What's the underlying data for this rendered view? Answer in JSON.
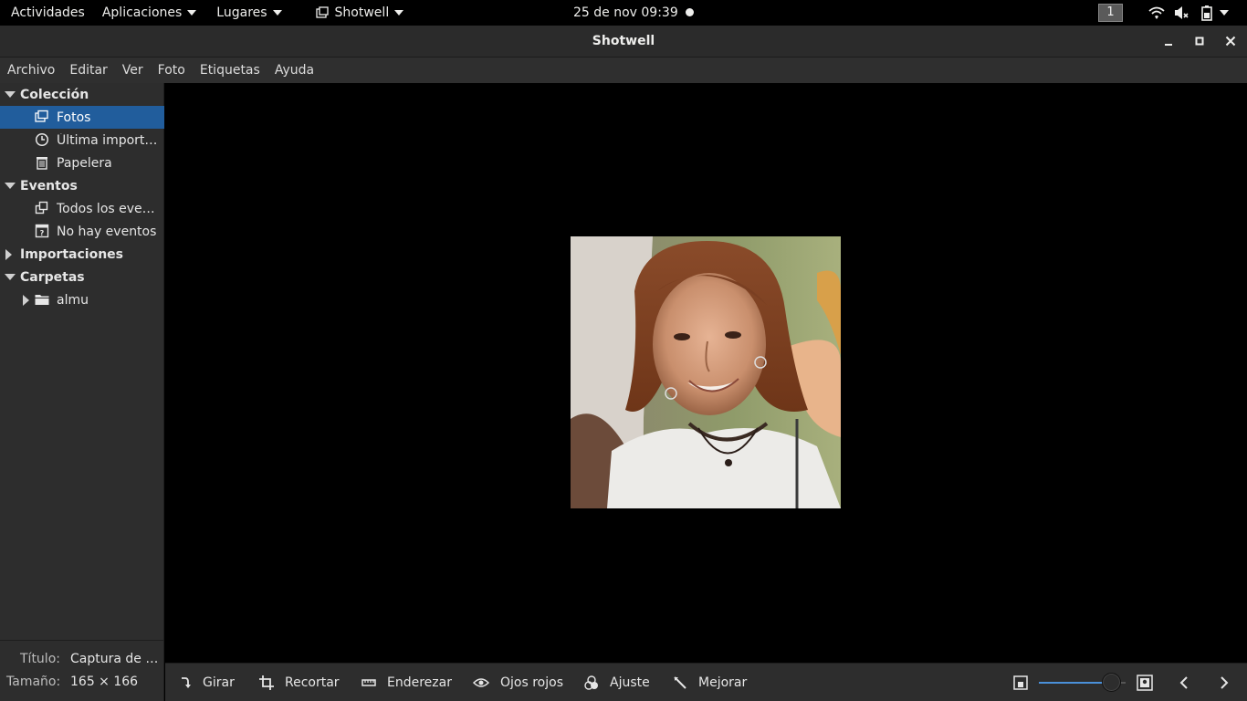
{
  "topbar": {
    "activities": "Actividades",
    "applications": "Aplicaciones",
    "places": "Lugares",
    "app_name": "Shotwell",
    "clock": "25 de nov  09:39",
    "workspace": "1"
  },
  "window": {
    "title": "Shotwell"
  },
  "menu": {
    "items": [
      "Archivo",
      "Editar",
      "Ver",
      "Foto",
      "Etiquetas",
      "Ayuda"
    ]
  },
  "sidebar": {
    "collection_header": "Colección",
    "photos": "Fotos",
    "last_import": "Última importa…",
    "trash": "Papelera",
    "events_header": "Eventos",
    "all_events": "Todos los event…",
    "no_events": "No hay eventos",
    "imports_header": "Importaciones",
    "folders_header": "Carpetas",
    "folder_almu": "almu"
  },
  "info": {
    "title_label": "Título:",
    "title_value": "Captura de pa…",
    "size_label": "Tamaño:",
    "size_value": "165 × 166"
  },
  "toolbar": {
    "rotate": "Girar",
    "crop": "Recortar",
    "straighten": "Enderezar",
    "red_eye": "Ojos rojos",
    "adjust": "Ajuste",
    "enhance": "Mejorar"
  },
  "colors": {
    "selection": "#215d9c",
    "accent": "#4a90d9",
    "background": "#2d2d2d"
  }
}
